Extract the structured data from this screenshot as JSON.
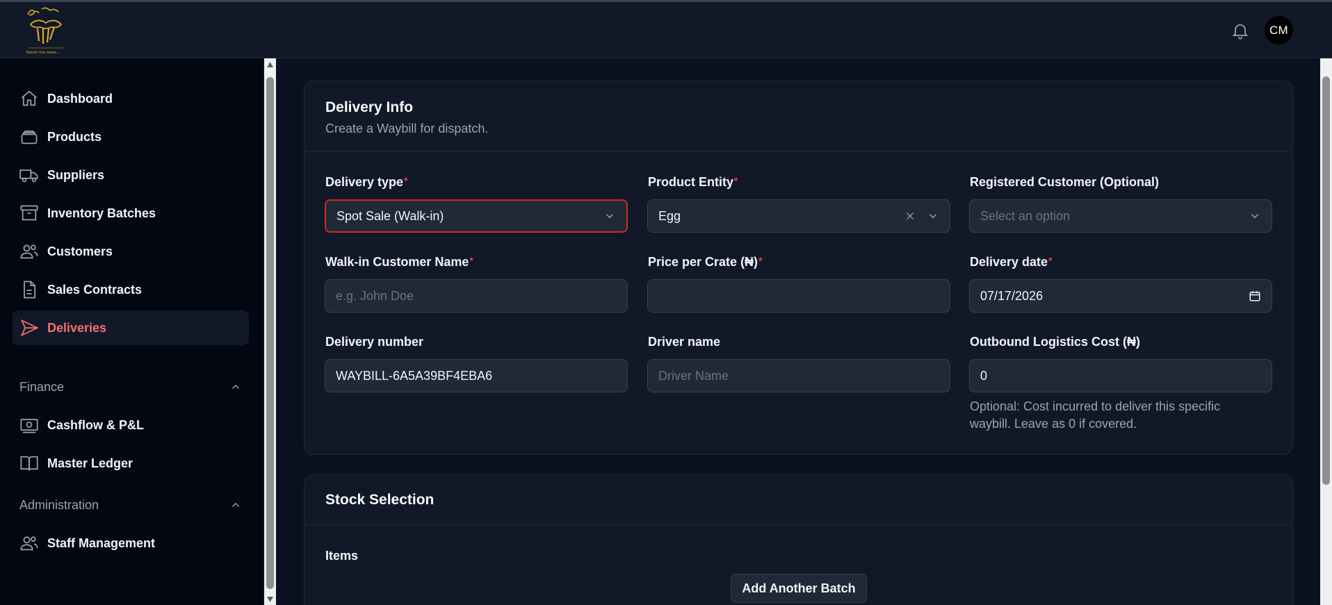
{
  "header": {
    "logo_text": "Auntie Jays — Relish the taste...",
    "avatar_initials": "CM"
  },
  "sidebar": {
    "items": [
      {
        "label": "Dashboard",
        "icon": "home-icon"
      },
      {
        "label": "Products",
        "icon": "products-icon"
      },
      {
        "label": "Suppliers",
        "icon": "truck-icon"
      },
      {
        "label": "Inventory Batches",
        "icon": "archive-icon"
      },
      {
        "label": "Customers",
        "icon": "users-icon"
      },
      {
        "label": "Sales Contracts",
        "icon": "document-icon"
      },
      {
        "label": "Deliveries",
        "icon": "send-icon",
        "active": true
      }
    ],
    "finance": {
      "label": "Finance",
      "items": [
        {
          "label": "Cashflow & P&L",
          "icon": "cash-icon"
        },
        {
          "label": "Master Ledger",
          "icon": "book-icon"
        }
      ]
    },
    "administration": {
      "label": "Administration",
      "items": [
        {
          "label": "Staff Management",
          "icon": "users-icon"
        }
      ]
    }
  },
  "delivery_info": {
    "title": "Delivery Info",
    "subtitle": "Create a Waybill for dispatch.",
    "fields": {
      "delivery_type": {
        "label": "Delivery type",
        "required": true,
        "value": "Spot Sale (Walk-in)"
      },
      "product_entity": {
        "label": "Product Entity",
        "required": true,
        "value": "Egg"
      },
      "registered_customer": {
        "label": "Registered Customer (Optional)",
        "placeholder": "Select an option"
      },
      "walkin_name": {
        "label": "Walk-in Customer Name",
        "required": true,
        "placeholder": "e.g. John Doe",
        "value": ""
      },
      "price_per_crate": {
        "label": "Price per Crate (₦)",
        "required": true,
        "value": ""
      },
      "delivery_date": {
        "label": "Delivery date",
        "required": true,
        "value": "07/17/2026"
      },
      "delivery_number": {
        "label": "Delivery number",
        "value": "WAYBILL-6A5A39BF4EBA6"
      },
      "driver_name": {
        "label": "Driver name",
        "placeholder": "Driver Name",
        "value": ""
      },
      "logistics_cost": {
        "label": "Outbound Logistics Cost (₦)",
        "value": "0",
        "help": "Optional: Cost incurred to deliver this specific waybill. Leave as 0 if covered."
      }
    }
  },
  "stock_selection": {
    "title": "Stock Selection",
    "items_label": "Items",
    "add_button": "Add Another Batch"
  },
  "colors": {
    "accent_active": "#f87171",
    "required": "#ef4444",
    "invalid_border": "#dc2626",
    "background": "#0b1120",
    "card": "#111827"
  }
}
